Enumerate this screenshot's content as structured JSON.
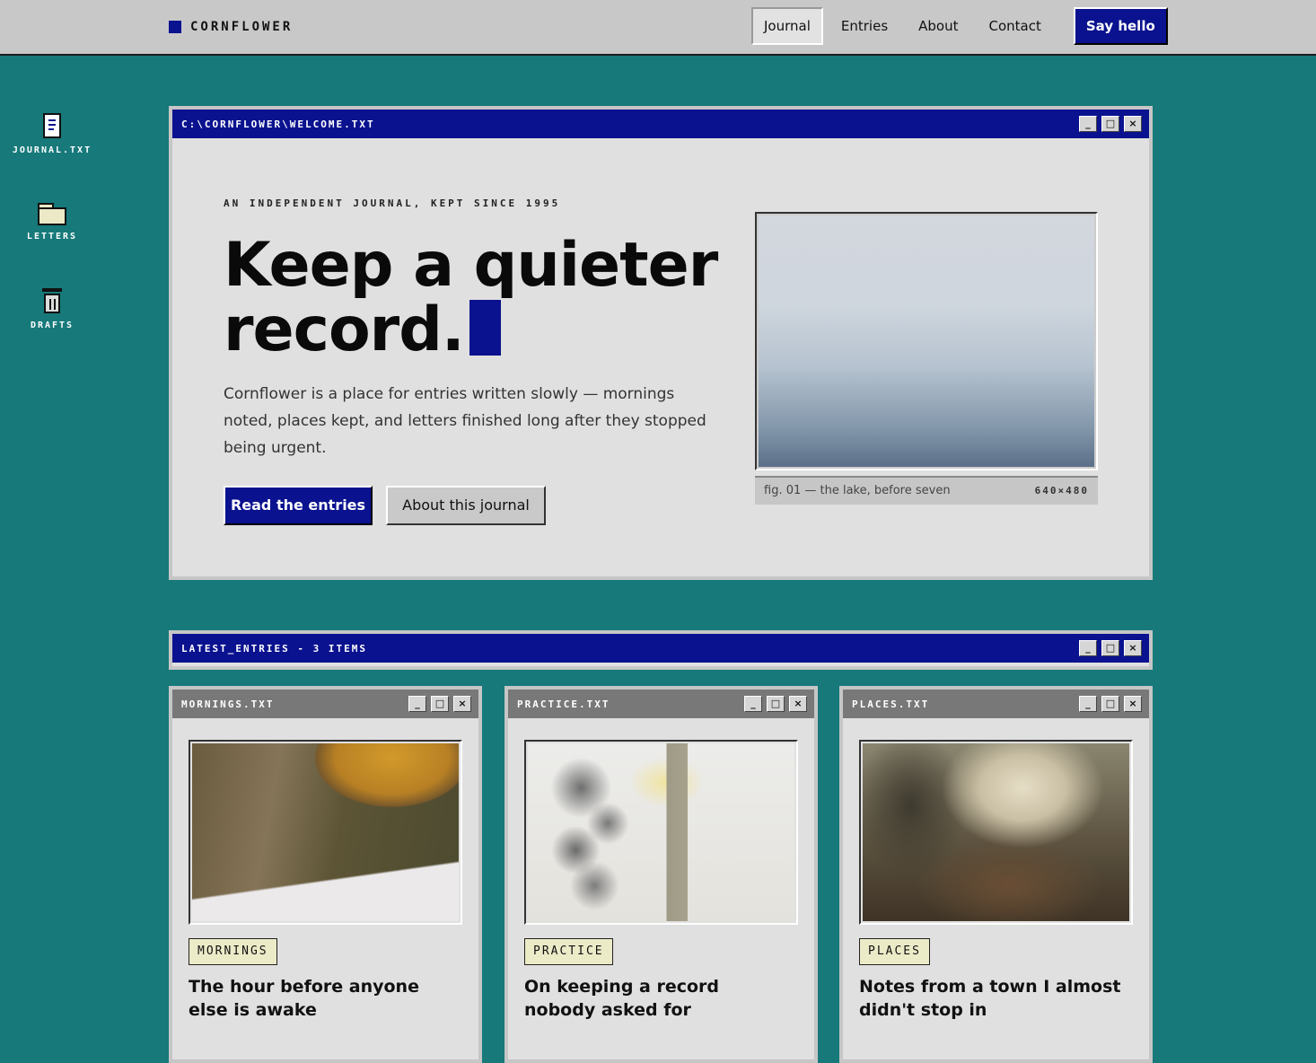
{
  "brand": {
    "name": "CORNFLOWER"
  },
  "nav": {
    "items": [
      "Journal",
      "Entries",
      "About",
      "Contact"
    ],
    "cta": "Say hello"
  },
  "desktop": {
    "icons": [
      {
        "label": "JOURNAL.TXT",
        "icon": "document-icon"
      },
      {
        "label": "LETTERS",
        "icon": "folder-icon"
      },
      {
        "label": "DRAFTS",
        "icon": "trash-icon"
      }
    ]
  },
  "hero": {
    "window_title": "C:\\CORNFLOWER\\WELCOME.TXT",
    "eyebrow": "AN INDEPENDENT JOURNAL, KEPT SINCE 1995",
    "title_line1": "Keep a quieter",
    "title_line2": "record.",
    "description": "Cornflower is a place for entries written slowly — mornings noted, places kept, and letters finished long after they stopped being urgent.",
    "primary_button": "Read the entries",
    "secondary_button": "About this journal",
    "figure_caption": "fig. 01 — the lake, before seven",
    "figure_dims": "640×480"
  },
  "latest": {
    "window_title": "LATEST_ENTRIES - 3 ITEMS",
    "cards": [
      {
        "file": "MORNINGS.TXT",
        "tag": "MORNINGS",
        "title": "The hour before anyone else is awake"
      },
      {
        "file": "PRACTICE.TXT",
        "tag": "PRACTICE",
        "title": "On keeping a record nobody asked for"
      },
      {
        "file": "PLACES.TXT",
        "tag": "PLACES",
        "title": "Notes from a town I almost didn't stop in"
      }
    ]
  },
  "window_buttons": {
    "minimize": "_",
    "maximize": "□",
    "close": "×"
  },
  "colors": {
    "desktop": "#17797a",
    "accent": "#0a128f",
    "window": "#e0e0e0",
    "tag": "#ecebc8"
  }
}
